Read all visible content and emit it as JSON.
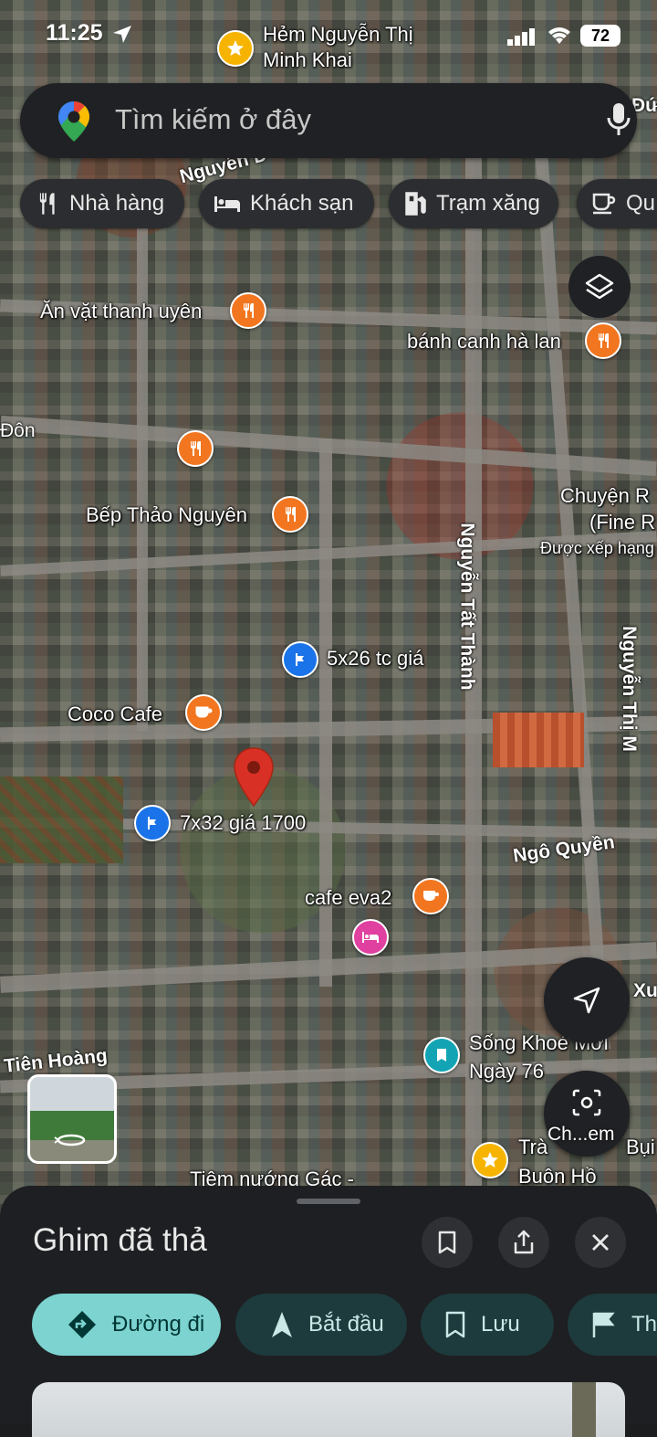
{
  "status_bar": {
    "time": "11:25",
    "battery": "72"
  },
  "search": {
    "placeholder": "Tìm kiếm ở đây"
  },
  "chips": [
    {
      "label": "Nhà hàng",
      "icon": "restaurant-icon"
    },
    {
      "label": "Khách sạn",
      "icon": "hotel-icon"
    },
    {
      "label": "Trạm xăng",
      "icon": "gas-station-icon"
    },
    {
      "label": "Qu",
      "icon": "coffee-icon"
    }
  ],
  "map": {
    "pois": [
      {
        "label": "Hẻm Nguyễn Thị",
        "label2": "Minh Khai",
        "type": "star"
      },
      {
        "label": "Ăn vặt thanh uyên",
        "type": "food"
      },
      {
        "label": "bánh canh hà lan",
        "type": "food"
      },
      {
        "label": "Bếp Thảo Nguyên",
        "type": "food"
      },
      {
        "label": "Chuyện R",
        "label2": "(Fine R",
        "label3": "Được xếp hạng",
        "type": "food"
      },
      {
        "label": "5x26 tc giá",
        "type": "flag"
      },
      {
        "label": "Coco Cafe",
        "type": "cafe"
      },
      {
        "label": "7x32 giá 1700",
        "type": "flag"
      },
      {
        "label": "cafe eva2",
        "type": "cafe"
      },
      {
        "label": "Sống Khoẻ Mới",
        "label2": "Ngày 76",
        "type": "teal"
      },
      {
        "label": "Trà",
        "label2": "Buôn Hồ",
        "type": "star"
      },
      {
        "label": "Bụi",
        "type": "food"
      },
      {
        "label": "Tiệm nướng Gác -",
        "type": "food"
      }
    ],
    "roads": [
      "Nguyễn Tất Thành",
      "Ngô Quyền",
      "Đôn",
      "Tiên Hoàng",
      "Xu",
      "Nguyễn D",
      "Nguyễn Thị M",
      "Đức"
    ],
    "camera_label": "Ch...em"
  },
  "sheet": {
    "title": "Ghim đã thả",
    "actions": [
      {
        "label": "Đường đi",
        "icon": "directions-icon"
      },
      {
        "label": "Bắt đầu",
        "icon": "navigation-arrow-icon"
      },
      {
        "label": "Lưu",
        "icon": "bookmark-icon"
      },
      {
        "label": "Th",
        "icon": "flag-icon"
      }
    ]
  },
  "colors": {
    "accent": "#7cd3d0",
    "pin": "#d93025",
    "food_poi": "#f2761f",
    "flag_poi": "#1a73e8"
  }
}
